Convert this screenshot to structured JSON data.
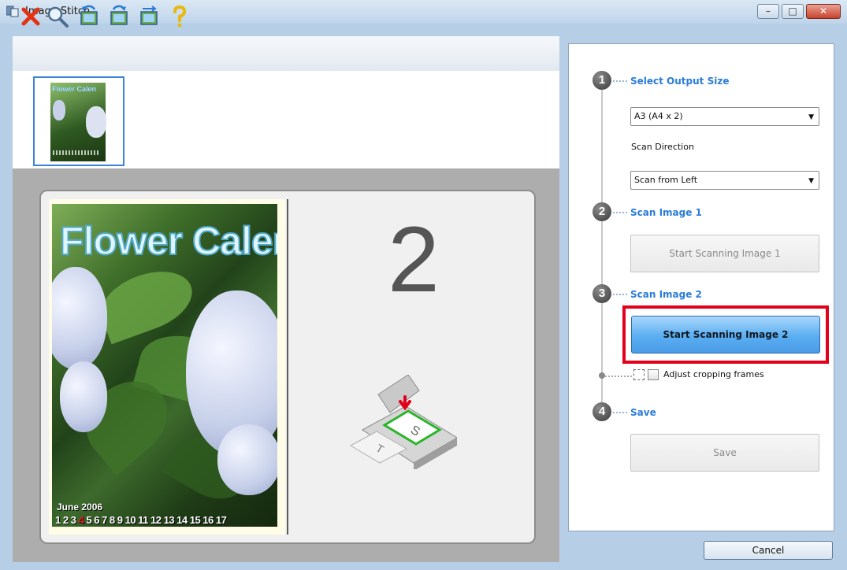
{
  "window": {
    "title": "Image Stitch",
    "controls": {
      "minimize": "–",
      "maximize": "□",
      "close": "✕"
    }
  },
  "toolbar": {
    "items": [
      {
        "name": "delete-icon"
      },
      {
        "name": "zoom-icon"
      },
      {
        "name": "rotate-left-icon"
      },
      {
        "name": "rotate-right-icon"
      },
      {
        "name": "swap-icon"
      },
      {
        "name": "help-icon"
      }
    ]
  },
  "thumbnail": {
    "title": "Flower Calen"
  },
  "preview": {
    "image": {
      "title": "Flower Calend",
      "date": "June 2006",
      "calendar_before": "1 2 3 ",
      "calendar_highlight": "4",
      "calendar_after": " 5 6 7 8 9 10 11 12 13 14 15 16 17"
    },
    "slot_number": "2"
  },
  "steps": [
    {
      "number": "1",
      "label": "Select Output Size"
    },
    {
      "number": "2",
      "label": "Scan Image 1"
    },
    {
      "number": "3",
      "label": "Scan Image 2"
    },
    {
      "number": "4",
      "label": "Save"
    }
  ],
  "output_size": {
    "selected": "A3 (A4 x 2)"
  },
  "scan_direction": {
    "label": "Scan Direction",
    "selected": "Scan from Left"
  },
  "buttons": {
    "scan1": "Start Scanning Image 1",
    "scan2": "Start Scanning Image 2",
    "save": "Save",
    "cancel": "Cancel"
  },
  "adjust_cropping": {
    "label": "Adjust cropping frames"
  },
  "colors": {
    "accent": "#2a7cd8",
    "highlight": "#e3001b",
    "primary_button": "#5aaef2"
  }
}
